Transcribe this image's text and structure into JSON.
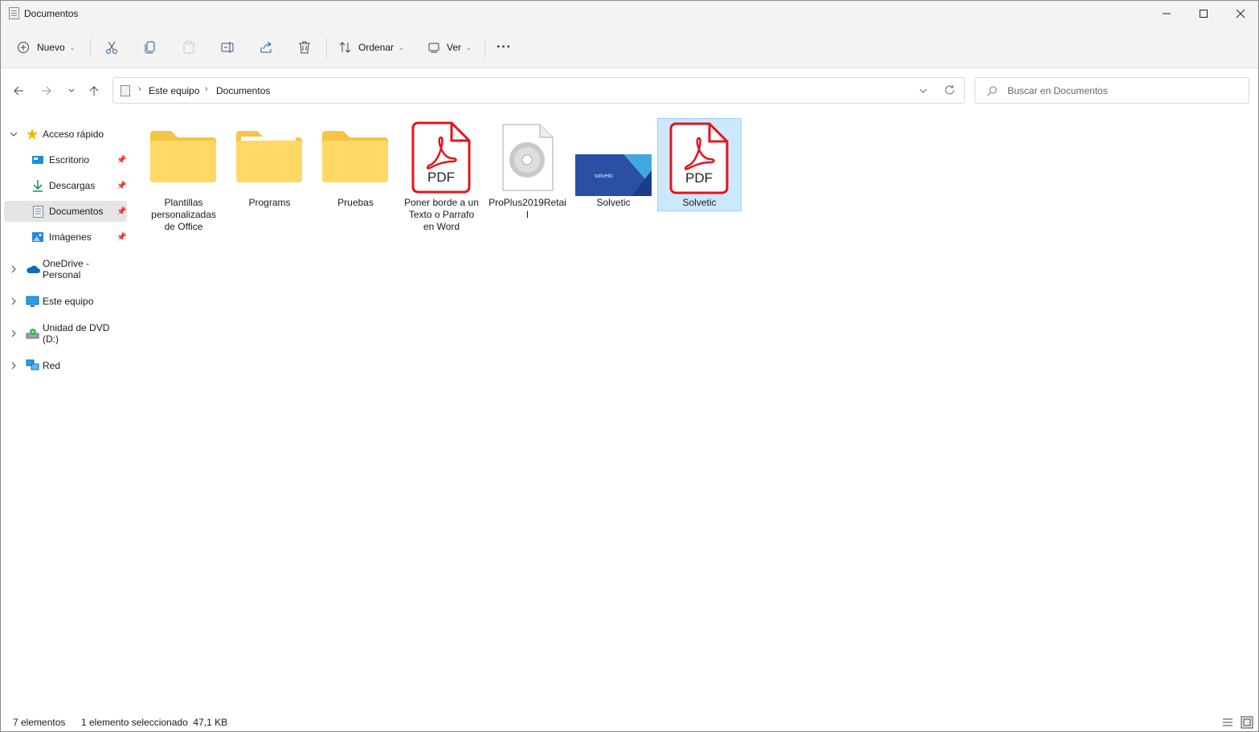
{
  "window": {
    "title": "Documentos"
  },
  "toolbar": {
    "new_label": "Nuevo",
    "sort_label": "Ordenar",
    "view_label": "Ver",
    "more_label": "···"
  },
  "address": {
    "crumbs": [
      "Este equipo",
      "Documentos"
    ],
    "search_placeholder": "Buscar en Documentos"
  },
  "sidebar": {
    "items": [
      {
        "label": "Acceso rápido",
        "icon": "star-icon"
      },
      {
        "label": "Escritorio",
        "icon": "desktop-icon"
      },
      {
        "label": "Descargas",
        "icon": "download-icon"
      },
      {
        "label": "Documentos",
        "icon": "documents-icon"
      },
      {
        "label": "Imágenes",
        "icon": "pictures-icon"
      },
      {
        "label": "OneDrive - Personal",
        "icon": "cloud-icon"
      },
      {
        "label": "Este equipo",
        "icon": "monitor-icon"
      },
      {
        "label": "Unidad de DVD (D:)",
        "icon": "dvd-drive-icon"
      },
      {
        "label": "Red",
        "icon": "network-icon"
      }
    ]
  },
  "files": [
    {
      "name": "Plantillas personalizadas de Office",
      "type": "folder"
    },
    {
      "name": "Programs",
      "type": "folder"
    },
    {
      "name": "Pruebas",
      "type": "folder"
    },
    {
      "name": "Poner borde a un Texto o Parrafo en Word",
      "type": "pdf",
      "icon_text": "PDF"
    },
    {
      "name": "ProPlus2019Retail",
      "type": "iso"
    },
    {
      "name": "Solvetic",
      "type": "image",
      "thumb_text": "solvetic"
    },
    {
      "name": "Solvetic",
      "type": "pdf",
      "icon_text": "PDF",
      "selected": true
    }
  ],
  "status": {
    "count": "7 elementos",
    "selection": "1 elemento seleccionado  47,1 KB"
  },
  "colors": {
    "accent": "#0067c0",
    "selected_bg": "#cce8ff",
    "folder": "#ffd35c",
    "pdf_red": "#e3141b"
  }
}
